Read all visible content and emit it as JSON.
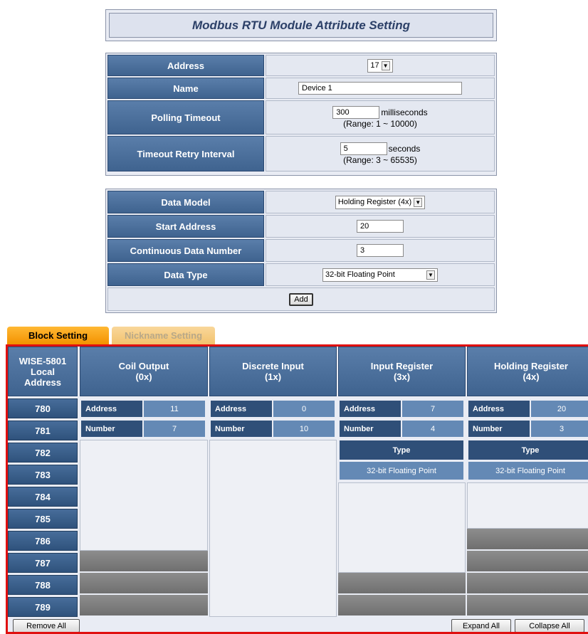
{
  "title": "Modbus RTU Module Attribute Setting",
  "module": {
    "address_label": "Address",
    "address_value": "17",
    "name_label": "Name",
    "name_value": "Device 1",
    "polling_label": "Polling Timeout",
    "polling_value": "300",
    "polling_unit": "milliseconds",
    "polling_range": "(Range: 1 ~ 10000)",
    "retry_label": "Timeout Retry Interval",
    "retry_value": "5",
    "retry_unit": "seconds",
    "retry_range": "(Range: 3 ~ 65535)"
  },
  "data_form": {
    "model_label": "Data Model",
    "model_value": "Holding Register (4x)",
    "start_label": "Start Address",
    "start_value": "20",
    "count_label": "Continuous Data Number",
    "count_value": "3",
    "type_label": "Data Type",
    "type_value": "32-bit Floating Point",
    "add_label": "Add"
  },
  "tabs": {
    "block": "Block Setting",
    "nickname": "Nickname Setting"
  },
  "block": {
    "local_header": [
      "WISE-5801",
      "Local",
      "Address"
    ],
    "rows": [
      "780",
      "781",
      "782",
      "783",
      "784",
      "785",
      "786",
      "787",
      "788",
      "789"
    ],
    "columns": [
      {
        "title": "Coil Output",
        "sub": "(0x)",
        "address": "11",
        "number": "7"
      },
      {
        "title": "Discrete Input",
        "sub": "(1x)",
        "address": "0",
        "number": "10"
      },
      {
        "title": "Input Register",
        "sub": "(3x)",
        "address": "7",
        "number": "4",
        "type": "32-bit Floating Point"
      },
      {
        "title": "Holding Register",
        "sub": "(4x)",
        "address": "20",
        "number": "3",
        "type": "32-bit Floating Point"
      }
    ],
    "address_label": "Address",
    "number_label": "Number",
    "type_label": "Type"
  },
  "buttons": {
    "remove_all": "Remove All",
    "expand_all": "Expand All",
    "collapse_all": "Collapse All"
  },
  "colors": {
    "header_blue": "#3f638f",
    "tab_orange": "#f39200",
    "frame_red": "#e01010"
  }
}
